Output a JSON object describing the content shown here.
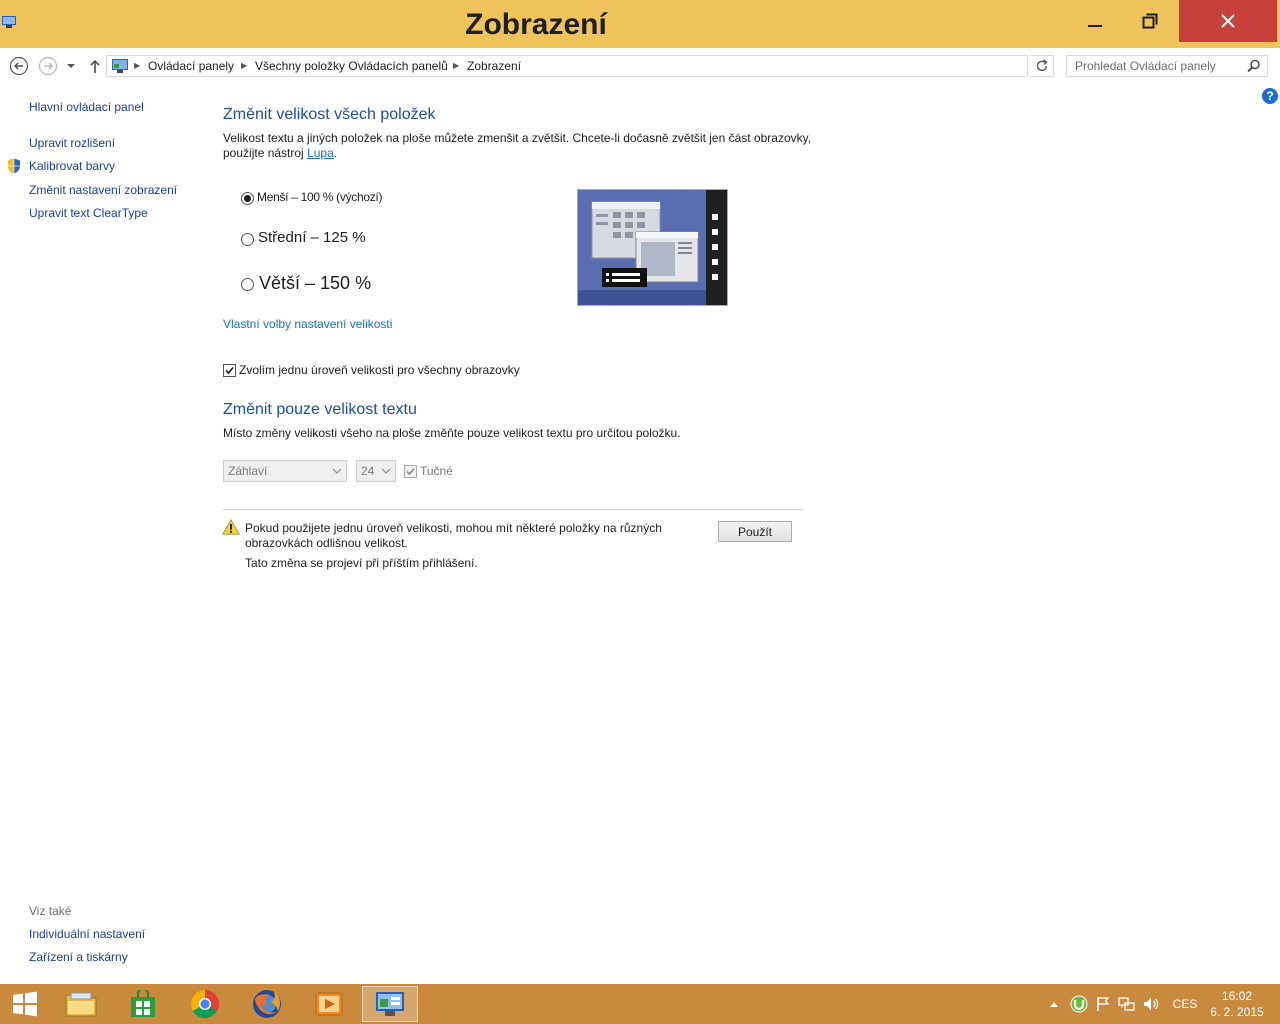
{
  "window": {
    "title": "Zobrazení"
  },
  "address": {
    "crumbs": [
      "Ovládací panely",
      "Všechny položky Ovládacích panelů",
      "Zobrazení"
    ],
    "search_placeholder": "Prohledat Ovládací panely"
  },
  "sidebar": {
    "home": "Hlavní ovládací panel",
    "links": [
      "Upravit rozlišení",
      "Kalibrovat barvy",
      "Změnit nastavení zobrazení",
      "Upravit text ClearType"
    ],
    "see_also_label": "Viz také",
    "see_also": [
      "Individuální nastavení",
      "Zařízení a tiskárny"
    ]
  },
  "main": {
    "heading1": "Změnit velikost všech položek",
    "desc1_line1": "Velikost textu a jiných položek na ploše můžete zmenšit a zvětšit. Chcete-li dočasně zvětšit jen část obrazovky,",
    "desc1_line2": "použijte nástroj",
    "desc1_link": "Lupa",
    "desc1_end": ".",
    "options": [
      {
        "label": "Menší – 100 % (výchozí)",
        "checked": true
      },
      {
        "label": "Střední – 125 %",
        "checked": false
      },
      {
        "label": "Větší – 150 %",
        "checked": false
      }
    ],
    "custom_link": "Vlastní volby nastavení velikosti",
    "one_level_checkbox": {
      "label": "Zvolím jednu úroveň velikosti pro všechny obrazovky",
      "checked": true
    },
    "heading2": "Změnit pouze velikost textu",
    "desc2": "Místo změny velikosti všeho na ploše změňte pouze velikost textu pro určitou položku.",
    "item_select": "Záhlaví",
    "size_select": "24",
    "bold_checkbox": {
      "label": "Tučné",
      "checked": true
    },
    "warning_line1": "Pokud použijete jednu úroveň velikosti, mohou mít některé položky na různých",
    "warning_line2": "obrazovkách odlišnou velikost.",
    "warning_line3": "Tato změna se projeví při příštím přihlášení.",
    "apply_label": "Použít"
  },
  "taskbar": {
    "language": "CES",
    "time": "16:02",
    "date": "6. 2. 2015"
  }
}
